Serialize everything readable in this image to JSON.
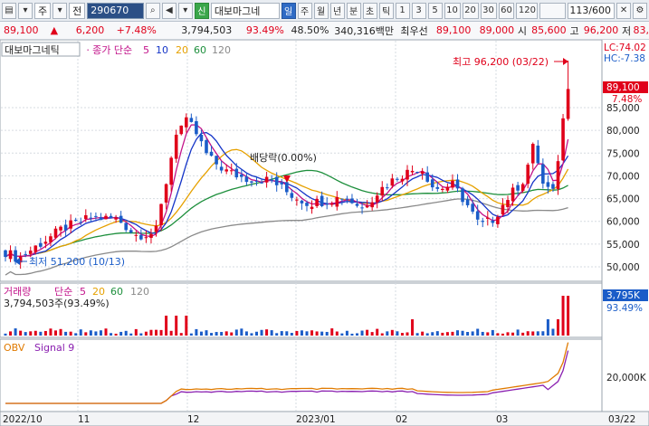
{
  "toolbar": {
    "market": "주",
    "prev": "전",
    "code": "290670",
    "badge": "신",
    "name": "대보마그네",
    "periods": [
      "일",
      "주",
      "월",
      "년",
      "분",
      "초",
      "틱"
    ],
    "active_period": "일",
    "intervals": [
      "1",
      "3",
      "5",
      "10",
      "20",
      "30",
      "60",
      "120"
    ],
    "counter": "113/600"
  },
  "info": {
    "price": "89,100",
    "change": "6,200",
    "pct": "+7.48%",
    "volume": "3,794,503",
    "vol_ratio": "93.49%",
    "turnover": "48.50%",
    "amount": "340,316백만",
    "best_label": "최우선",
    "best_sell": "89,100",
    "best_buy": "89,000",
    "open_label": "시",
    "open": "85,600",
    "high_label": "고",
    "high": "96,200",
    "low_label": "저",
    "low": "83,"
  },
  "price_panel": {
    "stock_label": "대보마그네틱",
    "ma_label": "종가 단순",
    "ma_periods": [
      {
        "label": "5",
        "color": "#c2138a"
      },
      {
        "label": "10",
        "color": "#1535c8"
      },
      {
        "label": "20",
        "color": "#e6a100"
      },
      {
        "label": "60",
        "color": "#1d8f3c"
      },
      {
        "label": "120",
        "color": "#8a8a8a"
      }
    ],
    "lc": "LC:74.02",
    "hc": "HC:-7.38",
    "high_note": "최고 96,200 (03/22)",
    "low_note": "최저 51,200 (10/13)",
    "dividend_note": "배당락(0.00%)",
    "current_price_tag": "89,100",
    "current_pct_tag": "7.48%",
    "y_ticks": [
      "85,000",
      "80,000",
      "75,000",
      "70,000",
      "65,000",
      "60,000",
      "55,000",
      "50,000"
    ]
  },
  "volume_panel": {
    "label": "거래량",
    "ma_label": "단순",
    "ma_periods": [
      {
        "label": "5",
        "color": "#c2138a"
      },
      {
        "label": "20",
        "color": "#e6a100"
      },
      {
        "label": "60",
        "color": "#1d8f3c"
      },
      {
        "label": "120",
        "color": "#8a8a8a"
      }
    ],
    "value_text": "3,794,503주(93.49%)",
    "tag_value": "3,795K",
    "tag_pct": "93.49%"
  },
  "obv_panel": {
    "label": "OBV",
    "signal_label": "Signal 9",
    "y_tick": "20,000K"
  },
  "x_axis": {
    "labels": [
      "2022/10",
      "11",
      "12",
      "2023/01",
      "02",
      "03",
      "03/22"
    ]
  },
  "colors": {
    "up": "#e0001a",
    "down": "#1a5cc8",
    "ma5": "#c2138a",
    "ma10": "#1535c8",
    "ma20": "#e6a100",
    "ma60": "#1d8f3c",
    "ma120": "#8a8a8a",
    "obv": "#e07a00",
    "signal": "#8a1fb0"
  }
}
